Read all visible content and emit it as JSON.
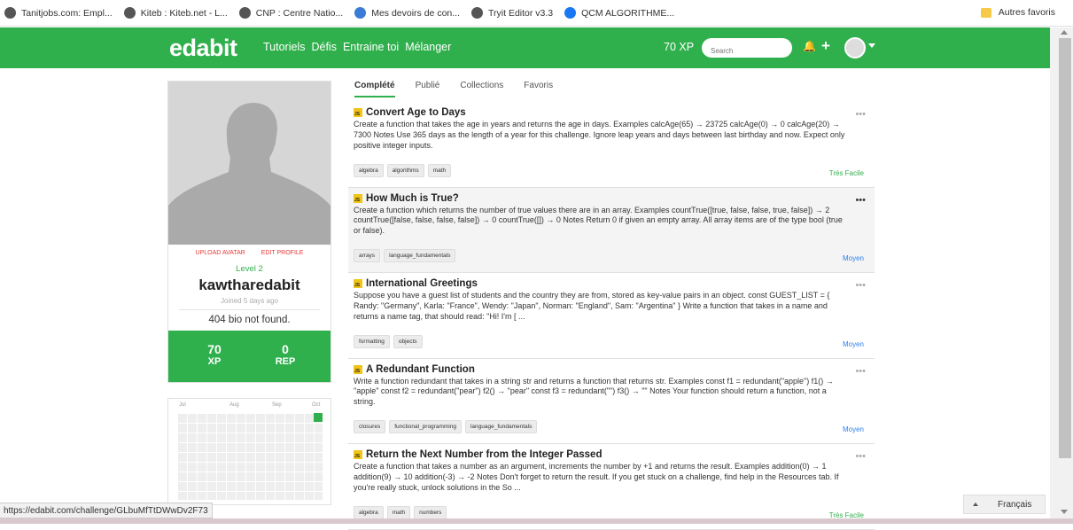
{
  "bookmarks": [
    {
      "label": "Tanitjobs.com: Empl...",
      "icon": "globe-icon",
      "color": "#555555"
    },
    {
      "label": "Kiteb : Kiteb.net - L...",
      "icon": "globe-icon",
      "color": "#555555"
    },
    {
      "label": "CNP : Centre Natio...",
      "icon": "globe-icon",
      "color": "#555555"
    },
    {
      "label": "Mes devoirs de con...",
      "icon": "chat-icon",
      "color": "#3a7bd5"
    },
    {
      "label": "Tryit Editor v3.3",
      "icon": "globe-icon",
      "color": "#555555"
    },
    {
      "label": "QCM ALGORITHME...",
      "icon": "facebook-icon",
      "color": "#1877f2"
    }
  ],
  "bookmarks_other": "Autres favoris",
  "nav": {
    "logo": "edabit",
    "links": [
      "Tutoriels",
      "Défis",
      "Entraine toi",
      "Mélanger"
    ],
    "xp": "70 XP",
    "search_placeholder": "Search",
    "accent": "#30b04d"
  },
  "profile": {
    "upload_avatar": "UPLOAD AVATAR",
    "edit_profile": "EDIT PROFILE",
    "level": "Level 2",
    "username": "kawtharedabit",
    "joined": "Joined 5 days ago",
    "bio": "404 bio not found.",
    "xp_value": "70",
    "xp_label": "XP",
    "rep_value": "0",
    "rep_label": "REP"
  },
  "heatmap": {
    "months": [
      "Jul",
      "Aug",
      "Sep",
      "Oct"
    ]
  },
  "tabs": [
    "Complété",
    "Publié",
    "Collections",
    "Favoris"
  ],
  "challenges": [
    {
      "title": "Convert Age to Days",
      "description": "Create a function that takes the age in years and returns the age in days. Examples calcAge(65) → 23725 calcAge(0) → 0 calcAge(20) → 7300 Notes Use 365 days as the length of a year for this challenge. Ignore leap years and days between last birthday and now. Expect only positive integer inputs.",
      "tags": [
        "algebra",
        "algorithms",
        "math"
      ],
      "difficulty": "Très Facile",
      "difficulty_color": "#30b04d"
    },
    {
      "title": "How Much is True?",
      "description": "Create a function which returns the number of true values there are in an array. Examples countTrue([true, false, false, true, false]) → 2 countTrue([false, false, false, false]) → 0 countTrue([]) → 0 Notes Return 0 if given an empty array. All array items are of the type bool (true or false).",
      "tags": [
        "arrays",
        "language_fundamentals"
      ],
      "difficulty": "Moyen",
      "difficulty_color": "#2f80ed"
    },
    {
      "title": "International Greetings",
      "description": "Suppose you have a guest list of students and the country they are from, stored as key-value pairs in an object. const GUEST_LIST = { Randy: \"Germany\", Karla: \"France\", Wendy: \"Japan\", Norman: \"England\", Sam: \"Argentina\" } Write a function that takes in a name and returns a name tag, that should read: \"Hi! I'm [ ...",
      "tags": [
        "formatting",
        "objects"
      ],
      "difficulty": "Moyen",
      "difficulty_color": "#2f80ed"
    },
    {
      "title": "A Redundant Function",
      "description": "Write a function redundant that takes in a string str and returns a function that returns str. Examples const f1 = redundant(\"apple\") f1() → \"apple\" const f2 = redundant(\"pear\") f2() → \"pear\" const f3 = redundant(\"\") f3() → \"\" Notes Your function should return a function, not a string.",
      "tags": [
        "closures",
        "functional_programming",
        "language_fundamentals"
      ],
      "difficulty": "Moyen",
      "difficulty_color": "#2f80ed"
    },
    {
      "title": "Return the Next Number from the Integer Passed",
      "description": "Create a function that takes a number as an argument, increments the number by +1 and returns the result. Examples addition(0) → 1 addition(9) → 10 addition(-3) → -2 Notes Don't forget to return the result. If you get stuck on a challenge, find help in the Resources tab. If you're really stuck, unlock solutions in the So ...",
      "tags": [
        "algebra",
        "math",
        "numbers"
      ],
      "difficulty": "Très Facile",
      "difficulty_color": "#30b04d"
    }
  ],
  "status_url": "https://edabit.com/challenge/GLbuMfTtDWwDv2F73",
  "language": "Français"
}
